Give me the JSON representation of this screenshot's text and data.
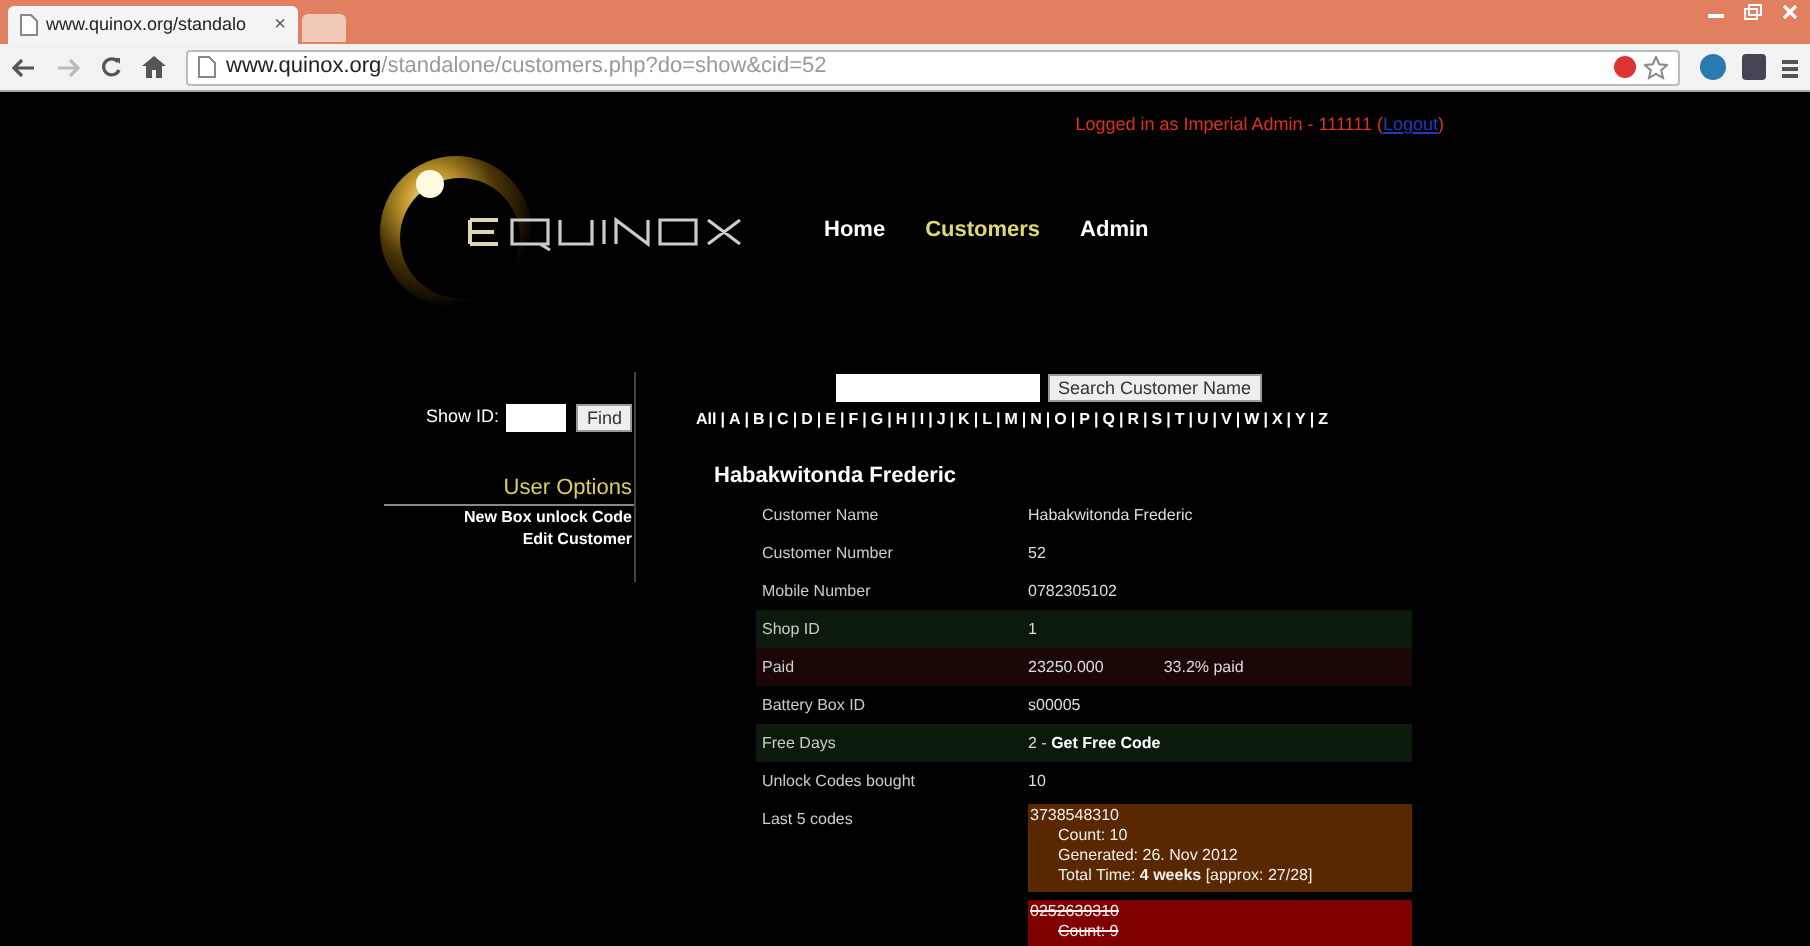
{
  "browser": {
    "tab_title": "www.quinox.org/standalo",
    "tab_close": "×",
    "url_host": "www.quinox.org",
    "url_path": "/standalone/customers.php?do=show&cid=52"
  },
  "header": {
    "login_text": "Logged in as Imperial Admin - 111111 (",
    "logout_link": "Logout",
    "login_close": ")",
    "nav": [
      {
        "label": "Home",
        "selected": false
      },
      {
        "label": "Customers",
        "selected": true
      },
      {
        "label": "Admin",
        "selected": false
      }
    ]
  },
  "sidebar": {
    "show_id_label": "Show ID:",
    "find_button": "Find",
    "options_title": "User Options",
    "links": [
      "New Box unlock Code",
      "Edit Customer"
    ]
  },
  "search": {
    "button": "Search Customer Name",
    "separator": "|",
    "letters": [
      "All",
      "A",
      "B",
      "C",
      "D",
      "E",
      "F",
      "G",
      "H",
      "I",
      "J",
      "K",
      "L",
      "M",
      "N",
      "O",
      "P",
      "Q",
      "R",
      "S",
      "T",
      "U",
      "V",
      "W",
      "X",
      "Y",
      "Z"
    ]
  },
  "customer": {
    "heading": "Habakwitonda Frederic",
    "rows": [
      {
        "label": "Customer Name",
        "value": "Habakwitonda Frederic"
      },
      {
        "label": "Customer Number",
        "value": "52"
      },
      {
        "label": "Mobile Number",
        "value": "0782305102"
      },
      {
        "label": "Shop ID",
        "value": "1",
        "color": "#0b1a0b"
      },
      {
        "label": "Paid",
        "value": "23250.000",
        "note": "33.2% paid",
        "color": "#1c0707"
      },
      {
        "label": "Battery Box ID",
        "value": "s00005"
      },
      {
        "label": "Free Days",
        "value": "2 - ",
        "link": "Get Free Code",
        "color": "#0b1a0b"
      },
      {
        "label": "Unlock Codes bought",
        "value": "10"
      },
      {
        "label": "Last 5 codes",
        "codes": [
          {
            "code": "3738548310",
            "kind": "active",
            "lines": [
              "Count: 10",
              "Generated: 26. Nov 2012",
              "Total Time: **4 weeks** [approx: 27/28]"
            ]
          },
          {
            "code": "0252639310",
            "kind": "voided",
            "lines": [
              "Count: 9"
            ]
          }
        ]
      }
    ]
  }
}
